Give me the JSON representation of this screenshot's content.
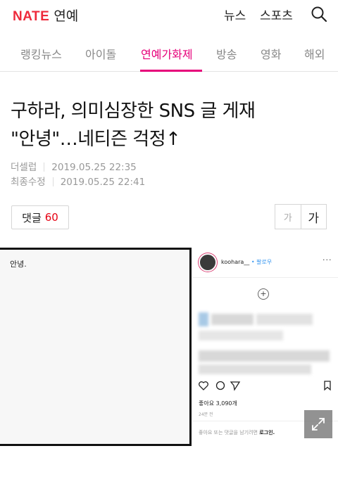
{
  "header": {
    "brand": "NATE",
    "section": "연예",
    "links": [
      "뉴스",
      "스포츠"
    ],
    "search_icon": "search-icon"
  },
  "tabs": [
    {
      "label": "랭킹뉴스",
      "active": false
    },
    {
      "label": "아이돌",
      "active": false
    },
    {
      "label": "연예가화제",
      "active": true
    },
    {
      "label": "방송",
      "active": false
    },
    {
      "label": "영화",
      "active": false
    },
    {
      "label": "해외",
      "active": false
    }
  ],
  "colors": {
    "brand": "#ee2a3b",
    "accent": "#e6007a",
    "count": "#e60012"
  },
  "article": {
    "headline_line1": "구하라, 의미심장한 SNS 글 게재",
    "headline_line2": "\"안녕\"…네티즌 걱정↑",
    "source": "더셀럽",
    "published": "2019.05.25 22:35",
    "modified_label": "최종수정",
    "modified": "2019.05.25 22:41"
  },
  "comments": {
    "label": "댓글",
    "count": "60"
  },
  "font_size": {
    "small": "가",
    "large": "가"
  },
  "image": {
    "left_text": "안녕.",
    "insta_user": "koohara__",
    "insta_follow": "• 팔로우",
    "insta_more": "···",
    "insta_plus": "+",
    "insta_likes": "좋아요 3,090개",
    "insta_time": "24분 전",
    "insta_login_prefix": "좋아요 또는 댓글을 남기려면",
    "insta_login_link": "로그인."
  }
}
